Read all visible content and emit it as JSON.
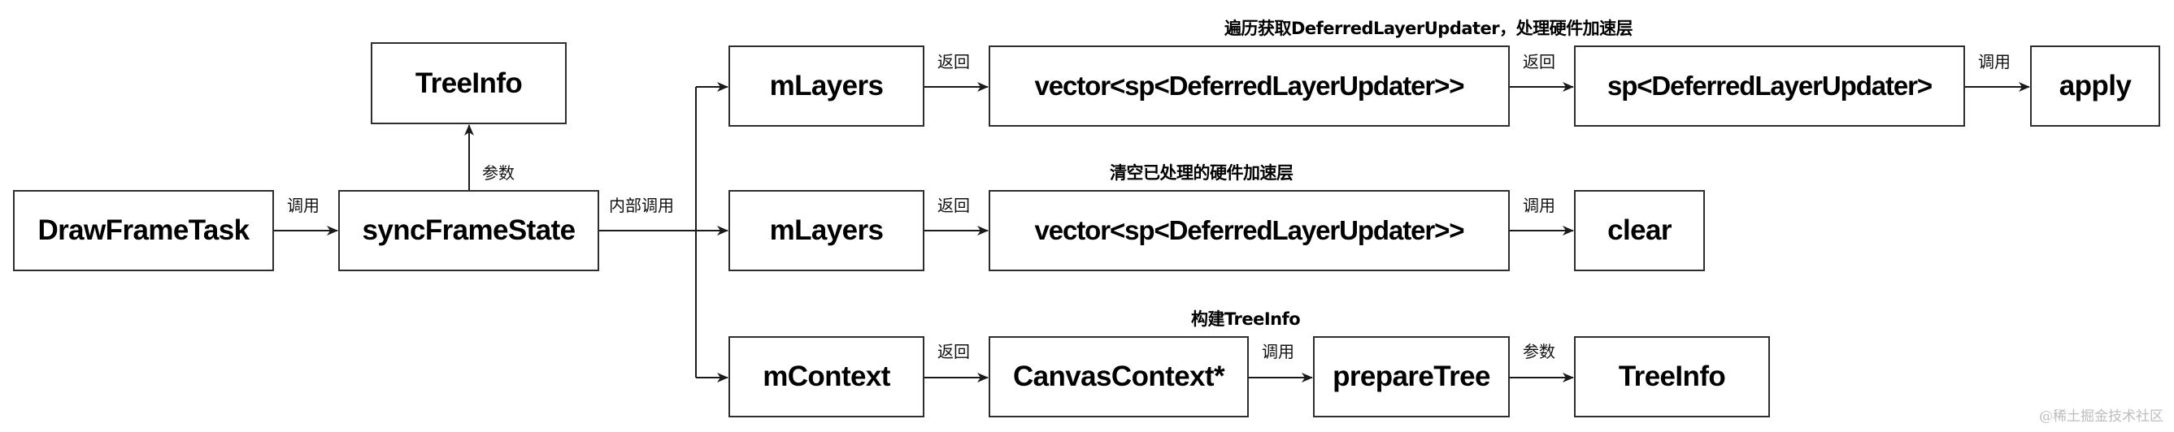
{
  "diagram": {
    "nodes": {
      "draw_frame_task": "DrawFrameTask",
      "sync_frame_state": "syncFrameState",
      "tree_info_top": "TreeInfo",
      "m_layers_1": "mLayers",
      "vector_1": "vector<sp<DeferredLayerUpdater>>",
      "sp_updater": "sp<DeferredLayerUpdater>",
      "apply": "apply",
      "m_layers_2": "mLayers",
      "vector_2": "vector<sp<DeferredLayerUpdater>>",
      "clear": "clear",
      "m_context": "mContext",
      "canvas_context": "CanvasContext*",
      "prepare_tree": "prepareTree",
      "tree_info_bottom": "TreeInfo"
    },
    "edge_labels": {
      "draw_to_sync": "调用",
      "sync_to_treeinfo": "参数",
      "sync_internal": "内部调用",
      "mlayers1_to_vector1": "返回",
      "vector1_to_sp": "返回",
      "sp_to_apply": "调用",
      "mlayers2_to_vector2": "返回",
      "vector2_to_clear": "调用",
      "mcontext_to_canvas": "返回",
      "canvas_to_prepare": "调用",
      "prepare_to_treeinfo": "参数"
    },
    "notes": {
      "row1": "遍历获取DeferredLayerUpdater，处理硬件加速层",
      "row2": "清空已处理的硬件加速层",
      "row3": "构建TreeInfo"
    }
  },
  "watermark": "@稀土掘金技术社区",
  "colors": {
    "border": "#2e2e2e",
    "line": "#1a1a1a",
    "text": "#000000",
    "watermark": "#bdbdbd"
  }
}
